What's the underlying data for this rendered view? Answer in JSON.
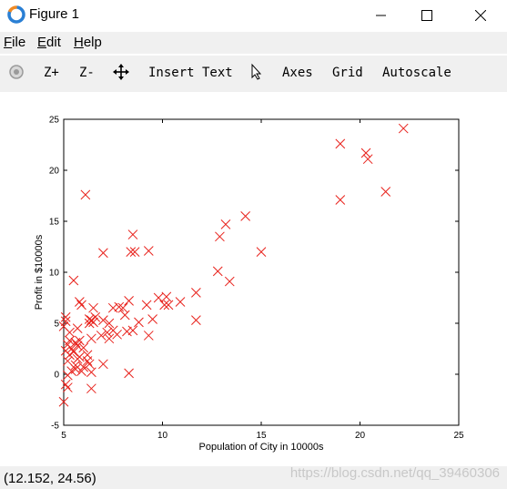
{
  "window": {
    "title": "Figure 1",
    "minimize_icon": "minimize-icon",
    "maximize_icon": "maximize-icon",
    "close_icon": "close-icon"
  },
  "menu": {
    "file": {
      "key": "F",
      "rest": "ile"
    },
    "edit": {
      "key": "E",
      "rest": "dit"
    },
    "help": {
      "key": "H",
      "rest": "elp"
    }
  },
  "toolbar": {
    "zoom_in": "Z+",
    "zoom_out": "Z-",
    "insert_text": "Insert Text",
    "axes": "Axes",
    "grid": "Grid",
    "autoscale": "Autoscale"
  },
  "status": {
    "coords": "(12.152, 24.56)",
    "watermark": "https://blog.csdn.net/qq_39460306"
  },
  "chart_data": {
    "type": "scatter",
    "title": "",
    "xlabel": "Population of City in 10000s",
    "ylabel": "Profit in $10000s",
    "xlim": [
      5,
      25
    ],
    "ylim": [
      -5,
      25
    ],
    "xticks": [
      "5",
      "10",
      "15",
      "20",
      "25"
    ],
    "yticks": [
      "-5",
      "0",
      "5",
      "10",
      "15",
      "20",
      "25"
    ],
    "marker": "x",
    "color": "#e8221c",
    "grid": false,
    "points": [
      [
        22.2,
        24.1
      ],
      [
        19.0,
        22.6
      ],
      [
        20.3,
        21.7
      ],
      [
        20.4,
        21.1
      ],
      [
        21.3,
        17.9
      ],
      [
        19.0,
        17.1
      ],
      [
        6.1,
        17.6
      ],
      [
        14.2,
        15.5
      ],
      [
        13.2,
        14.7
      ],
      [
        12.9,
        13.5
      ],
      [
        8.5,
        13.7
      ],
      [
        9.3,
        12.1
      ],
      [
        8.4,
        12.0
      ],
      [
        8.6,
        12.0
      ],
      [
        7.0,
        11.9
      ],
      [
        15.0,
        12.0
      ],
      [
        12.8,
        10.1
      ],
      [
        13.4,
        9.1
      ],
      [
        5.5,
        9.2
      ],
      [
        11.7,
        8.0
      ],
      [
        9.8,
        7.5
      ],
      [
        10.2,
        7.6
      ],
      [
        10.9,
        7.1
      ],
      [
        10.1,
        6.8
      ],
      [
        10.3,
        6.8
      ],
      [
        8.3,
        7.2
      ],
      [
        9.2,
        6.8
      ],
      [
        7.5,
        6.5
      ],
      [
        7.8,
        6.6
      ],
      [
        8.0,
        6.5
      ],
      [
        5.9,
        6.8
      ],
      [
        5.8,
        7.1
      ],
      [
        6.5,
        6.5
      ],
      [
        11.7,
        5.3
      ],
      [
        9.5,
        5.4
      ],
      [
        8.8,
        5.1
      ],
      [
        8.1,
        5.8
      ],
      [
        7.3,
        5.0
      ],
      [
        7.0,
        5.3
      ],
      [
        6.4,
        5.3
      ],
      [
        6.3,
        5.4
      ],
      [
        6.5,
        5.1
      ],
      [
        6.6,
        5.6
      ],
      [
        6.3,
        5.0
      ],
      [
        5.1,
        5.6
      ],
      [
        5.1,
        5.2
      ],
      [
        5.0,
        4.7
      ],
      [
        5.3,
        4.1
      ],
      [
        5.7,
        4.5
      ],
      [
        7.5,
        4.3
      ],
      [
        7.2,
        4.1
      ],
      [
        7.7,
        3.9
      ],
      [
        8.2,
        4.2
      ],
      [
        8.5,
        4.3
      ],
      [
        9.3,
        3.8
      ],
      [
        7.3,
        3.5
      ],
      [
        6.9,
        3.8
      ],
      [
        6.4,
        3.5
      ],
      [
        5.8,
        3.3
      ],
      [
        5.6,
        3.1
      ],
      [
        5.3,
        3.3
      ],
      [
        5.2,
        2.9
      ],
      [
        5.7,
        2.8
      ],
      [
        6.0,
        2.6
      ],
      [
        5.5,
        2.2
      ],
      [
        5.1,
        2.3
      ],
      [
        5.3,
        1.9
      ],
      [
        5.8,
        1.7
      ],
      [
        6.2,
        1.9
      ],
      [
        6.3,
        1.0
      ],
      [
        5.7,
        1.5
      ],
      [
        5.2,
        1.3
      ],
      [
        5.6,
        0.9
      ],
      [
        6.0,
        0.7
      ],
      [
        5.4,
        0.3
      ],
      [
        5.9,
        0.3
      ],
      [
        6.4,
        0.2
      ],
      [
        5.2,
        -0.1
      ],
      [
        5.6,
        0.5
      ],
      [
        7.0,
        1.0
      ],
      [
        8.3,
        0.1
      ],
      [
        5.1,
        -1.0
      ],
      [
        5.2,
        -1.3
      ],
      [
        6.4,
        -1.4
      ],
      [
        5.0,
        -2.7
      ],
      [
        6.2,
        1.3
      ],
      [
        5.4,
        2.5
      ]
    ]
  }
}
